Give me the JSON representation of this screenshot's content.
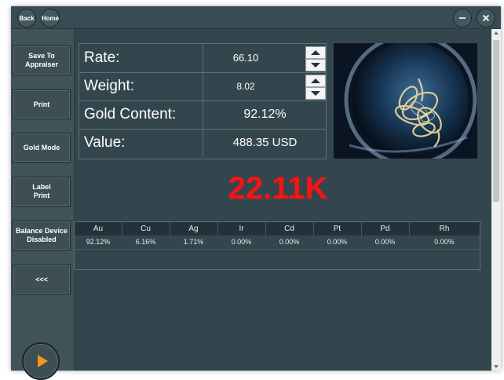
{
  "titlebar": {
    "back_label": "Back",
    "home_label": "Home",
    "minimize_icon": "minimize-icon",
    "close_icon": "close-icon"
  },
  "sidebar": {
    "save_to_appraiser": "Save To\nAppraiser",
    "print": "Print",
    "gold_mode": "Gold Mode",
    "label_print": "Label\nPrint",
    "balance_device": "Balance Device\nDisabled",
    "collapse": "<<<",
    "play_icon": "play-icon"
  },
  "readings": {
    "rate_label": "Rate:",
    "rate_value": "66.10",
    "weight_label": "Weight:",
    "weight_value": "8.02",
    "gold_content_label": "Gold Content:",
    "gold_content_value": "92.12%",
    "value_label": "Value:",
    "value_value": "488.35 USD"
  },
  "karat": "22.11K",
  "composition": {
    "headers": [
      "Au",
      "Cu",
      "Ag",
      "Ir",
      "Cd",
      "Pt",
      "Pd",
      "Rh"
    ],
    "values": [
      "92.12%",
      "6.16%",
      "1.71%",
      "0.00%",
      "0.00%",
      "0.00%",
      "0.00%",
      "0.00%"
    ]
  },
  "colors": {
    "accent_play": "#f39a12",
    "karat_red": "#ff1111"
  }
}
